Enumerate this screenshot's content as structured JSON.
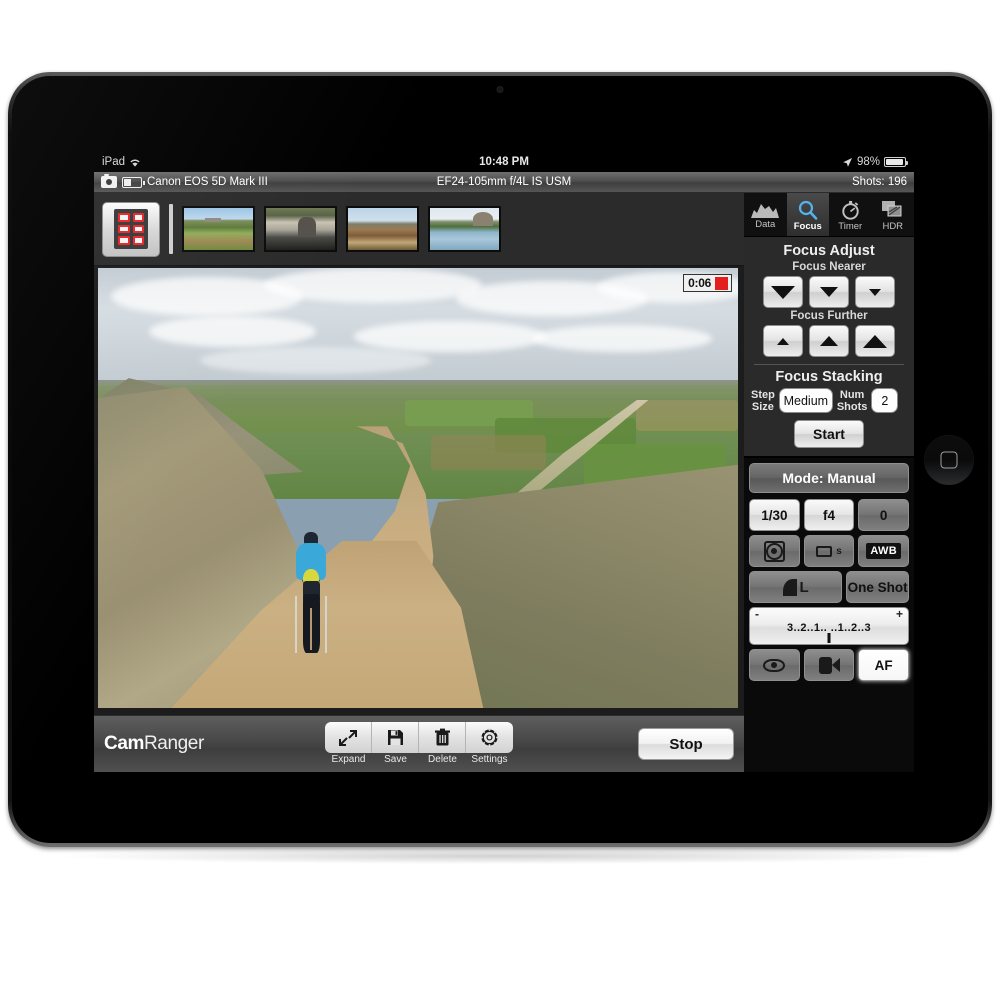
{
  "status_bar": {
    "device": "iPad",
    "wifi_icon": "wifi-icon",
    "time": "10:48 PM",
    "location_icon": "location-arrow-icon",
    "battery_percent": "98%",
    "battery_icon": "battery-icon"
  },
  "info_bar": {
    "camera_icon": "camera-icon",
    "battery_icon": "camera-battery-icon",
    "camera_model": "Canon EOS 5D Mark III",
    "lens": "EF24-105mm f/4L IS USM",
    "shots": "Shots: 196"
  },
  "thumbnail_strip": {
    "grid_button": "grid-view-button",
    "thumbnails": [
      {
        "name": "thumbnail-1"
      },
      {
        "name": "thumbnail-2"
      },
      {
        "name": "thumbnail-3"
      },
      {
        "name": "thumbnail-4"
      }
    ]
  },
  "live_view": {
    "timer": "0:06",
    "recording_indicator": "record-dot"
  },
  "tabs": [
    {
      "label": "Data",
      "icon": "histogram-icon",
      "selected": false
    },
    {
      "label": "Focus",
      "icon": "magnifier-icon",
      "selected": true
    },
    {
      "label": "Timer",
      "icon": "stopwatch-icon",
      "selected": false
    },
    {
      "label": "HDR",
      "icon": "layers-icon",
      "selected": false
    }
  ],
  "focus_panel": {
    "title": "Focus Adjust",
    "nearer_label": "Focus Nearer",
    "further_label": "Focus Further",
    "stacking_title": "Focus Stacking",
    "step_size_label_1": "Step",
    "step_size_label_2": "Size",
    "step_size_value": "Medium",
    "num_shots_label_1": "Num",
    "num_shots_label_2": "Shots",
    "num_shots_value": "2",
    "start_label": "Start"
  },
  "settings_panel": {
    "mode": "Mode: Manual",
    "shutter_speed": "1/30",
    "aperture": "f4",
    "exposure_comp": "0",
    "metering_icon": "metering-mode-icon",
    "drive_mode_letter": "s",
    "white_balance": "AWB",
    "quality_letter": "L",
    "af_mode": "One Shot",
    "meter_minus": "-",
    "meter_plus": "+",
    "meter_scale": "3..2..1..  ..1..2..3",
    "live_view_icon": "eye-icon",
    "video_icon": "video-camera-icon",
    "af_label": "AF"
  },
  "toolbar": {
    "brand_bold": "Cam",
    "brand_light": "Ranger",
    "tools": [
      {
        "label": "Expand",
        "icon": "expand-icon"
      },
      {
        "label": "Save",
        "icon": "floppy-disk-icon"
      },
      {
        "label": "Delete",
        "icon": "trash-icon"
      },
      {
        "label": "Settings",
        "icon": "gear-icon"
      }
    ],
    "stop_label": "Stop"
  }
}
